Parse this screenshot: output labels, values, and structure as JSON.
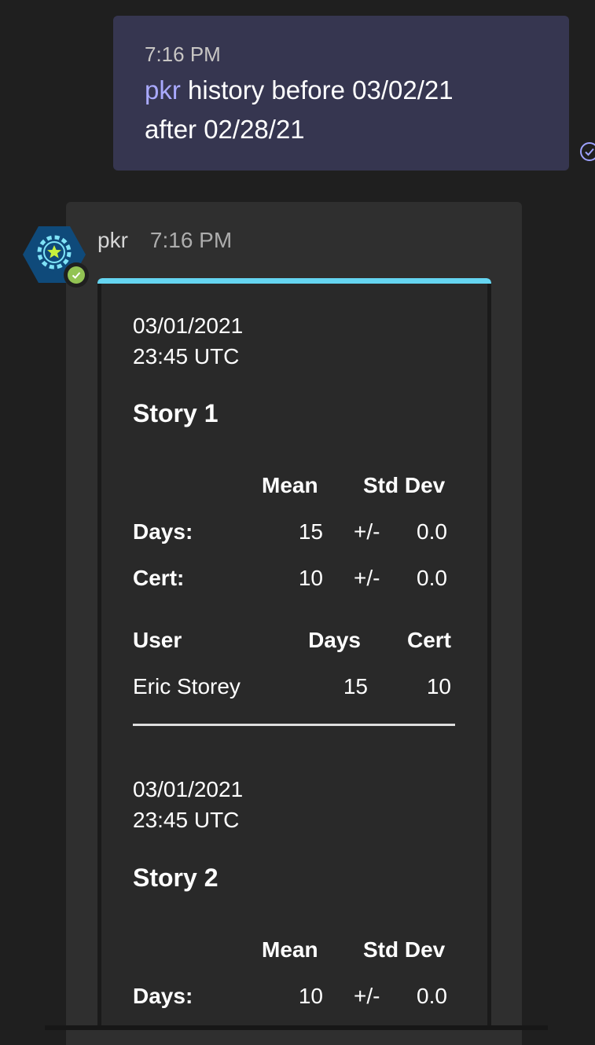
{
  "sent_message": {
    "time": "7:16 PM",
    "mention": "pkr",
    "text_line1": " history before 03/02/21",
    "text_line2": "after 02/28/21"
  },
  "bot_message": {
    "sender": "pkr",
    "time": "7:16 PM"
  },
  "stories": [
    {
      "date": "03/01/2021",
      "time": "23:45 UTC",
      "title": "Story 1",
      "stats_header": {
        "mean": "Mean",
        "std_dev": "Std Dev"
      },
      "stats": [
        {
          "label": "Days:",
          "mean": "15",
          "pm": "+/-",
          "std": "0.0"
        },
        {
          "label": "Cert:",
          "mean": "10",
          "pm": "+/-",
          "std": "0.0"
        }
      ],
      "users_header": {
        "user": "User",
        "days": "Days",
        "cert": "Cert"
      },
      "users": [
        {
          "user": "Eric Storey",
          "days": "15",
          "cert": "10"
        }
      ]
    },
    {
      "date": "03/01/2021",
      "time": "23:45 UTC",
      "title": "Story 2",
      "stats_header": {
        "mean": "Mean",
        "std_dev": "Std Dev"
      },
      "stats": [
        {
          "label": "Days:",
          "mean": "10",
          "pm": "+/-",
          "std": "0.0"
        }
      ]
    }
  ],
  "colors": {
    "accent": "#65d5f1",
    "mention": "#aaaaff",
    "status_available": "#92c353",
    "sent_bubble": "#363650"
  },
  "icons": {
    "avatar": "poker-chip-star-icon",
    "status": "available-check-icon",
    "read_receipt": "read-check-icon"
  }
}
